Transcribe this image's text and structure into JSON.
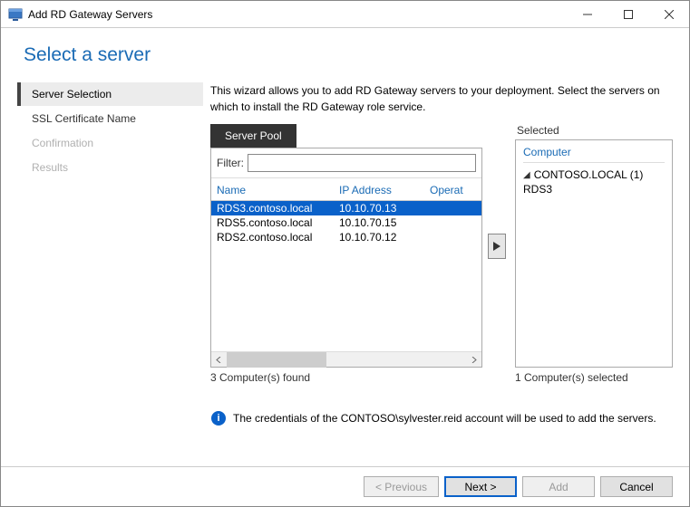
{
  "window": {
    "title": "Add RD Gateway Servers"
  },
  "page_title": "Select a server",
  "sidebar": {
    "items": [
      {
        "label": "Server Selection",
        "state": "active"
      },
      {
        "label": "SSL Certificate Name",
        "state": "normal"
      },
      {
        "label": "Confirmation",
        "state": "disabled"
      },
      {
        "label": "Results",
        "state": "disabled"
      }
    ]
  },
  "instructions": "This wizard allows you to add RD Gateway servers to your deployment. Select the servers on which to install the RD Gateway role service.",
  "pool": {
    "tab_label": "Server Pool",
    "filter_label": "Filter:",
    "filter_value": "",
    "columns": {
      "name": "Name",
      "ip": "IP Address",
      "os": "Operat"
    },
    "rows": [
      {
        "name": "RDS3.contoso.local",
        "ip": "10.10.70.13",
        "selected": true
      },
      {
        "name": "RDS5.contoso.local",
        "ip": "10.10.70.15",
        "selected": false
      },
      {
        "name": "RDS2.contoso.local",
        "ip": "10.10.70.12",
        "selected": false
      }
    ],
    "found_label": "3 Computer(s) found"
  },
  "selected": {
    "heading": "Selected",
    "column": "Computer",
    "group_label": "CONTOSO.LOCAL (1)",
    "items": [
      "RDS3"
    ],
    "count_label": "1 Computer(s) selected"
  },
  "note": "The credentials of the CONTOSO\\sylvester.reid account will be used to add the servers.",
  "buttons": {
    "previous": "< Previous",
    "next": "Next >",
    "add": "Add",
    "cancel": "Cancel"
  }
}
